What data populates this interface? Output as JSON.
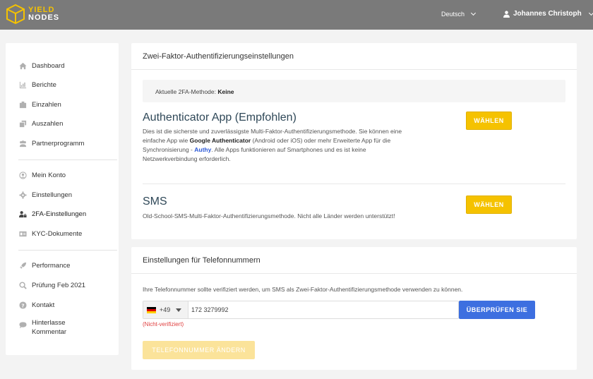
{
  "header": {
    "logo_line1": "YIELD",
    "logo_line2": "NODES",
    "language": "Deutsch",
    "user_name": "Johannes Christoph"
  },
  "sidebar": {
    "items": [
      {
        "label": "Dashboard",
        "icon": "home-icon"
      },
      {
        "label": "Berichte",
        "icon": "chart-icon"
      },
      {
        "label": "Einzahlen",
        "icon": "deposit-icon"
      },
      {
        "label": "Auszahlen",
        "icon": "withdraw-icon"
      },
      {
        "label": "Partnerprogramm",
        "icon": "users-icon"
      },
      {
        "label": "Mein Konto",
        "icon": "user-icon"
      },
      {
        "label": "Einstellungen",
        "icon": "gear-icon"
      },
      {
        "label": "2FA-Einstellungen",
        "icon": "user-lock-icon"
      },
      {
        "label": "KYC-Dokumente",
        "icon": "id-card-icon"
      },
      {
        "label": "Performance",
        "icon": "rocket-icon"
      },
      {
        "label": "Prüfung Feb 2021",
        "icon": "search-icon"
      },
      {
        "label": "Kontakt",
        "icon": "question-icon"
      },
      {
        "label": "Hinterlasse",
        "label2": "Kommentar",
        "icon": "comment-icon"
      }
    ],
    "active": "2FA-Einstellungen"
  },
  "twofa": {
    "title": "Zwei-Faktor-Authentifizierungseinstellungen",
    "current_label": "Aktuelle 2FA-Methode:",
    "current_value": "Keine",
    "app_heading": "Authenticator App (Empfohlen)",
    "app_desc_1": "Dies ist die sicherste und zuverlässigste Multi-Faktor-Authentifizierungsmethode. Sie können eine",
    "app_desc_2a": "einfache App wie ",
    "app_desc_2b": "Google Authenticator",
    "app_desc_2c": " (Android oder iOS) oder mehr Erweiterte App für die",
    "app_desc_3a": "Synchronisierung - ",
    "app_desc_3b": "Authy",
    "app_desc_3c": ". Alle Apps funktionieren auf Smartphones und es ist keine",
    "app_desc_4": "Netzwerkverbindung erforderlich.",
    "choose_label": "WÄHLEN",
    "sms_heading": "SMS",
    "sms_desc": "Old-School-SMS-Multi-Faktor-Authentifizierungsmethode. Nicht alle Länder werden unterstützt!"
  },
  "phone": {
    "title": "Einstellungen für Telefonnummern",
    "info": "Ihre Telefonnummer sollte verifiziert werden, um SMS als Zwei-Faktor-Authentifizierungsmethode verwenden zu können.",
    "country_code": "+49",
    "number": "172 3279992",
    "verify_label": "ÜBERPRÜFEN SIE",
    "status": "(Nicht-verifiziert)",
    "change_label": "TELEFONNUMMER ÄNDERN"
  }
}
